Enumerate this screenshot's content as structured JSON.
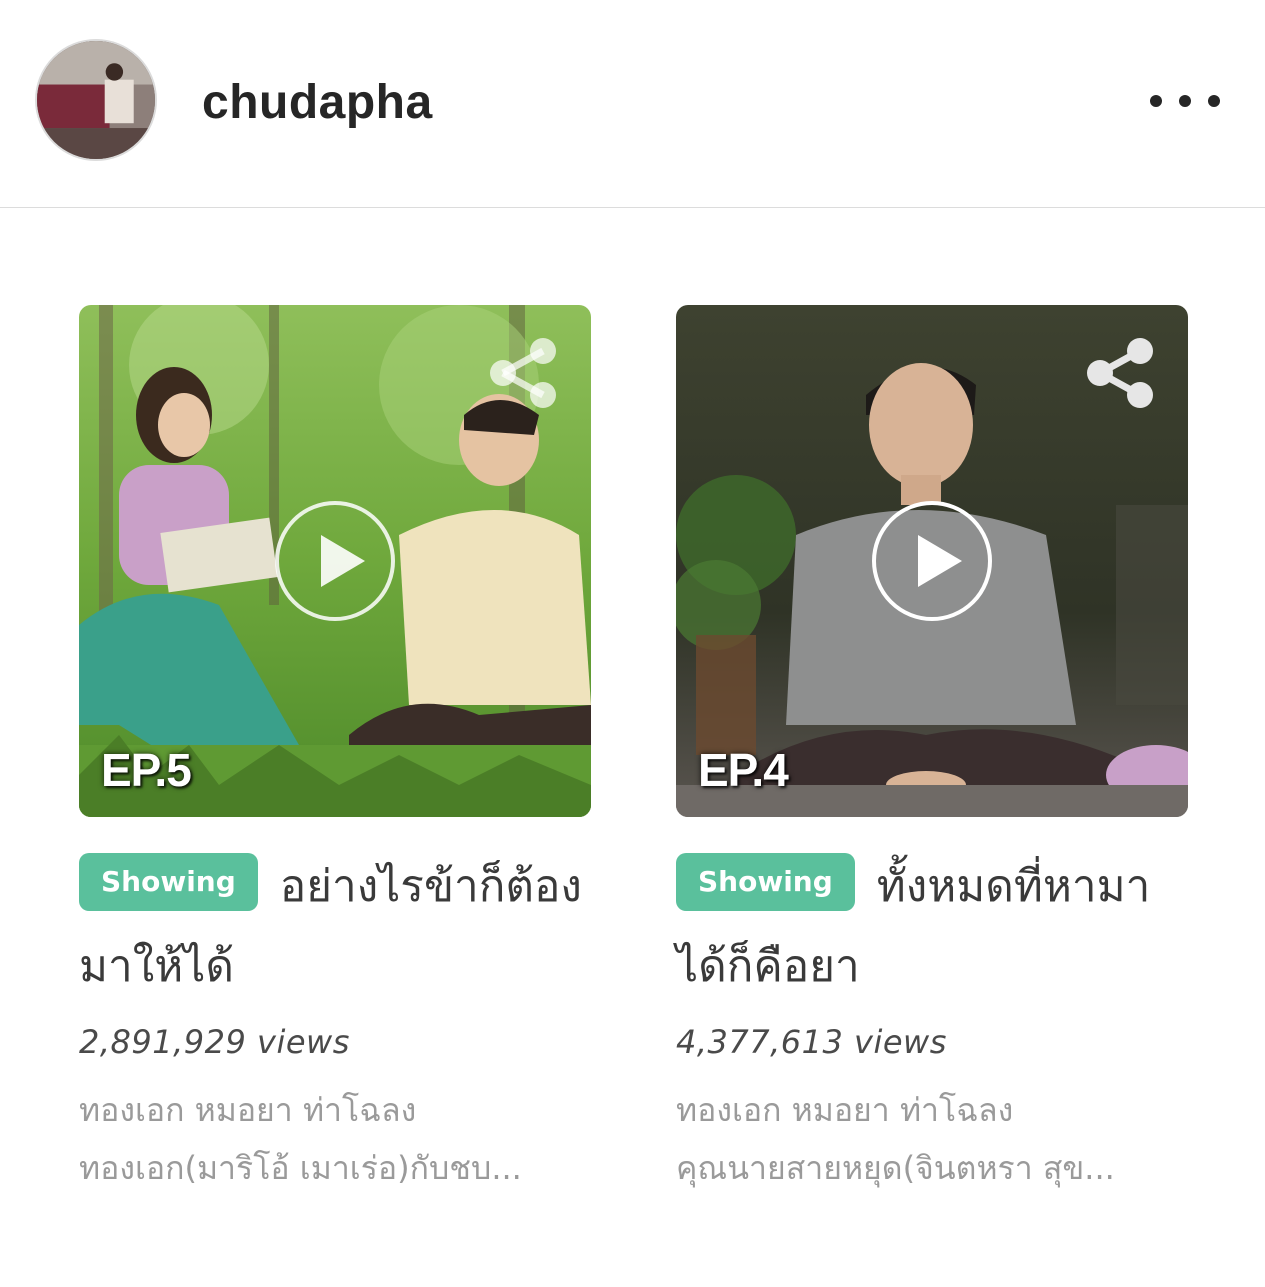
{
  "header": {
    "username": "chudapha",
    "more_icon": "more-horizontal-icon"
  },
  "videos": [
    {
      "episode": "EP.5",
      "badge": "Showing",
      "title": "อย่างไรข้าก็ต้องมาให้ได้",
      "views": "2,891,929  views",
      "desc_line1": "ทองเอก หมอยา ท่าโฉลง",
      "desc_line2": "ทองเอก(มาริโอ้ เมาเร่อ)กับชบ...",
      "badge_color": "#5ac09c"
    },
    {
      "episode": "EP.4",
      "badge": "Showing",
      "title": "ทั้งหมดที่หามาได้ก็คือยา",
      "views": "4,377,613  views",
      "desc_line1": "ทองเอก หมอยา ท่าโฉลง",
      "desc_line2": "คุณนายสายหยุด(จินตหรา สุข...",
      "badge_color": "#5ac09c"
    }
  ]
}
